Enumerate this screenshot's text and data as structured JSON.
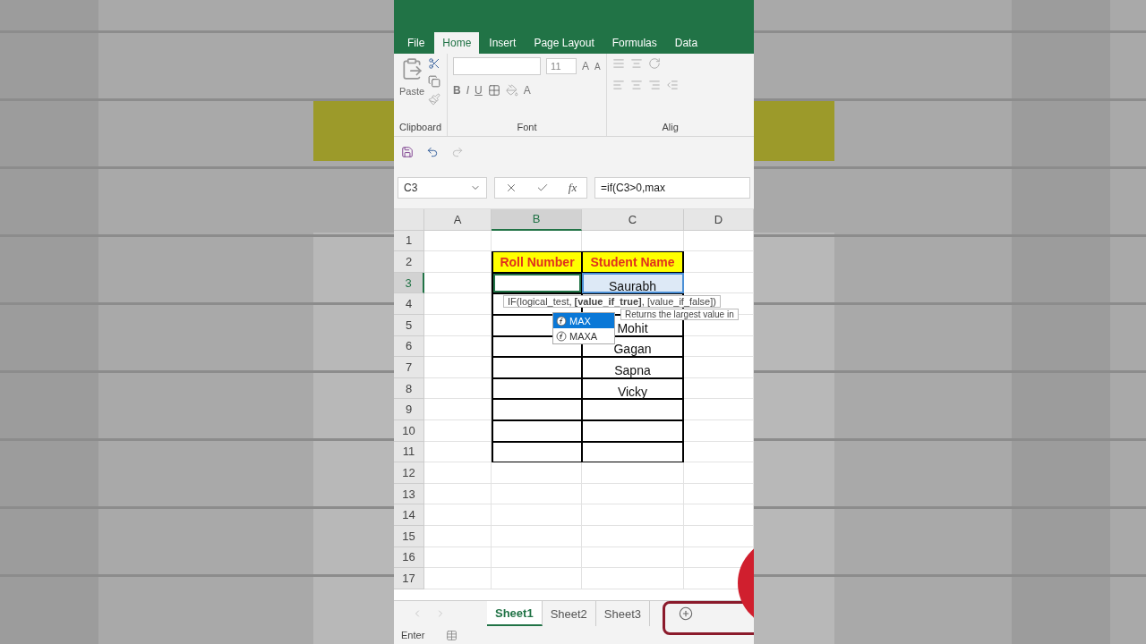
{
  "ribbon_tabs": [
    {
      "label": "File",
      "selected": false
    },
    {
      "label": "Home",
      "selected": true
    },
    {
      "label": "Insert",
      "selected": false
    },
    {
      "label": "Page Layout",
      "selected": false
    },
    {
      "label": "Formulas",
      "selected": false
    },
    {
      "label": "Data",
      "selected": false
    }
  ],
  "ribbon": {
    "paste_label": "Paste",
    "font_size": "11",
    "grow_font": "A",
    "shrink_font": "A",
    "style_buttons": [
      "B",
      "I",
      "U"
    ],
    "font_color": "A",
    "groups": [
      "Clipboard",
      "Font",
      "Alig"
    ]
  },
  "name_box": "C3",
  "fx_label": "fx",
  "formula": "=if(C3>0,max",
  "columns": [
    {
      "label": "A",
      "selected": false
    },
    {
      "label": "B",
      "selected": true
    },
    {
      "label": "C",
      "selected": false
    },
    {
      "label": "D",
      "selected": false
    }
  ],
  "rows": [
    {
      "number": "1",
      "kind": "plain",
      "selected": false
    },
    {
      "number": "2",
      "kind": "header",
      "selected": false,
      "b": "Roll Number",
      "c": "Student Name"
    },
    {
      "number": "3",
      "kind": "table",
      "selected": true,
      "c": "Saurabh"
    },
    {
      "number": "4",
      "kind": "table",
      "selected": false
    },
    {
      "number": "5",
      "kind": "table",
      "selected": false,
      "c": "Mohit"
    },
    {
      "number": "6",
      "kind": "table",
      "selected": false,
      "c": "Gagan"
    },
    {
      "number": "7",
      "kind": "table",
      "selected": false,
      "c": "Sapna"
    },
    {
      "number": "8",
      "kind": "table",
      "selected": false,
      "c": "Vicky"
    },
    {
      "number": "9",
      "kind": "table",
      "selected": false
    },
    {
      "number": "10",
      "kind": "table",
      "selected": false
    },
    {
      "number": "11",
      "kind": "table",
      "selected": false
    },
    {
      "number": "12",
      "kind": "plain",
      "selected": false
    },
    {
      "number": "13",
      "kind": "plain",
      "selected": false
    },
    {
      "number": "14",
      "kind": "plain",
      "selected": false
    },
    {
      "number": "15",
      "kind": "plain",
      "selected": false
    },
    {
      "number": "16",
      "kind": "plain",
      "selected": false
    },
    {
      "number": "17",
      "kind": "plain",
      "selected": false
    }
  ],
  "tooltip": "IF(logical_test, **[value_if_true]**, [value_if_false])",
  "autocomplete": [
    {
      "label": "MAX",
      "selected": true
    },
    {
      "label": "MAXA",
      "selected": false
    }
  ],
  "function_hint": "Returns the largest value in",
  "sheets": [
    {
      "label": "Sheet1",
      "selected": true
    },
    {
      "label": "Sheet2",
      "selected": false
    },
    {
      "label": "Sheet3",
      "selected": false
    }
  ],
  "status": "Enter"
}
